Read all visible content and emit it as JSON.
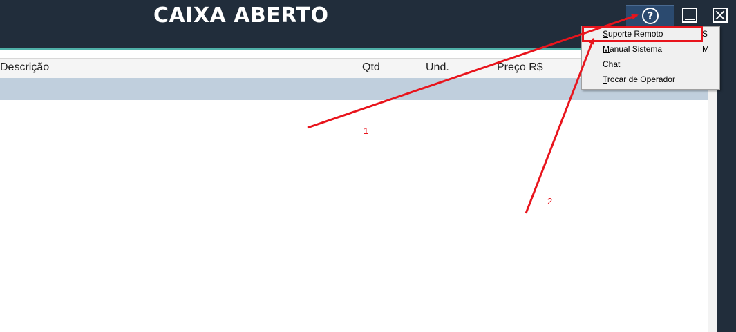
{
  "window": {
    "title": "CAIXA ABERTO"
  },
  "toolbar": {
    "help_icon": "help-circle-icon",
    "minimize_icon": "minimize-icon",
    "close_icon": "close-icon"
  },
  "table": {
    "columns": [
      "Descrição",
      "Qtd",
      "Und.",
      "Preço R$"
    ]
  },
  "menu": {
    "items": [
      {
        "label_underline": "S",
        "label_rest": "uporte Remoto",
        "shortcut": "S"
      },
      {
        "label_underline": "M",
        "label_rest": "anual Sistema",
        "shortcut": "M"
      },
      {
        "label_underline": "C",
        "label_rest": "hat",
        "shortcut": ""
      },
      {
        "label_underline": "T",
        "label_rest": "rocar de Operador",
        "shortcut": ""
      }
    ]
  },
  "annotations": {
    "label_1": "1",
    "label_2": "2",
    "color": "#e8141c"
  },
  "colors": {
    "header_bg": "#212d3b",
    "accent_line": "#4fb0a8",
    "selected_row": "#c0cfdd",
    "help_button_bg": "#2b4a6f"
  }
}
